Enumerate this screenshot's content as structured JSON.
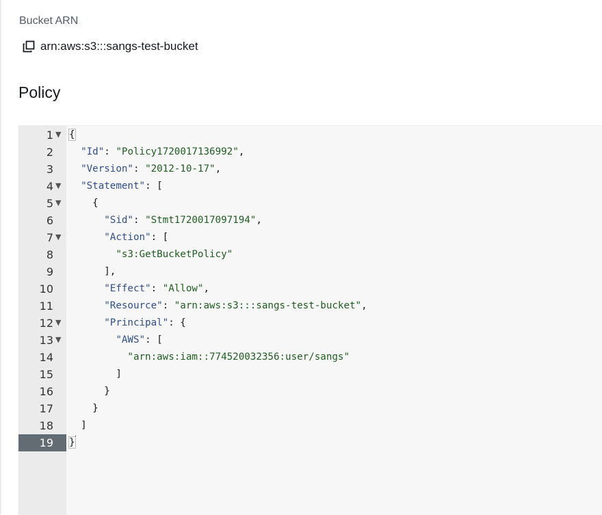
{
  "bucket_arn": {
    "label": "Bucket ARN",
    "value": "arn:aws:s3:::sangs-test-bucket",
    "copy_icon": "copy-icon"
  },
  "policy": {
    "title": "Policy",
    "active_line": 19,
    "lines": [
      {
        "num": "1",
        "fold": true,
        "tokens": [
          [
            "p",
            "{"
          ]
        ]
      },
      {
        "num": "2",
        "fold": false,
        "tokens": [
          [
            "p",
            "  "
          ],
          [
            "k",
            "\"Id\""
          ],
          [
            "p",
            ": "
          ],
          [
            "s",
            "\"Policy1720017136992\""
          ],
          [
            "p",
            ","
          ]
        ]
      },
      {
        "num": "3",
        "fold": false,
        "tokens": [
          [
            "p",
            "  "
          ],
          [
            "k",
            "\"Version\""
          ],
          [
            "p",
            ": "
          ],
          [
            "s",
            "\"2012-10-17\""
          ],
          [
            "p",
            ","
          ]
        ]
      },
      {
        "num": "4",
        "fold": true,
        "tokens": [
          [
            "p",
            "  "
          ],
          [
            "k",
            "\"Statement\""
          ],
          [
            "p",
            ": ["
          ]
        ]
      },
      {
        "num": "5",
        "fold": true,
        "tokens": [
          [
            "p",
            "    {"
          ]
        ]
      },
      {
        "num": "6",
        "fold": false,
        "tokens": [
          [
            "p",
            "      "
          ],
          [
            "k",
            "\"Sid\""
          ],
          [
            "p",
            ": "
          ],
          [
            "s",
            "\"Stmt1720017097194\""
          ],
          [
            "p",
            ","
          ]
        ]
      },
      {
        "num": "7",
        "fold": true,
        "tokens": [
          [
            "p",
            "      "
          ],
          [
            "k",
            "\"Action\""
          ],
          [
            "p",
            ": ["
          ]
        ]
      },
      {
        "num": "8",
        "fold": false,
        "tokens": [
          [
            "p",
            "        "
          ],
          [
            "s",
            "\"s3:GetBucketPolicy\""
          ]
        ]
      },
      {
        "num": "9",
        "fold": false,
        "tokens": [
          [
            "p",
            "      ],"
          ]
        ]
      },
      {
        "num": "10",
        "fold": false,
        "tokens": [
          [
            "p",
            "      "
          ],
          [
            "k",
            "\"Effect\""
          ],
          [
            "p",
            ": "
          ],
          [
            "s",
            "\"Allow\""
          ],
          [
            "p",
            ","
          ]
        ]
      },
      {
        "num": "11",
        "fold": false,
        "tokens": [
          [
            "p",
            "      "
          ],
          [
            "k",
            "\"Resource\""
          ],
          [
            "p",
            ": "
          ],
          [
            "s",
            "\"arn:aws:s3:::sangs-test-bucket\""
          ],
          [
            "p",
            ","
          ]
        ]
      },
      {
        "num": "12",
        "fold": true,
        "tokens": [
          [
            "p",
            "      "
          ],
          [
            "k",
            "\"Principal\""
          ],
          [
            "p",
            ": {"
          ]
        ]
      },
      {
        "num": "13",
        "fold": true,
        "tokens": [
          [
            "p",
            "        "
          ],
          [
            "k",
            "\"AWS\""
          ],
          [
            "p",
            ": ["
          ]
        ]
      },
      {
        "num": "14",
        "fold": false,
        "tokens": [
          [
            "p",
            "          "
          ],
          [
            "s",
            "\"arn:aws:iam::774520032356:user/sangs\""
          ]
        ]
      },
      {
        "num": "15",
        "fold": false,
        "tokens": [
          [
            "p",
            "        ]"
          ]
        ]
      },
      {
        "num": "16",
        "fold": false,
        "tokens": [
          [
            "p",
            "      }"
          ]
        ]
      },
      {
        "num": "17",
        "fold": false,
        "tokens": [
          [
            "p",
            "    }"
          ]
        ]
      },
      {
        "num": "18",
        "fold": false,
        "tokens": [
          [
            "p",
            "  ]"
          ]
        ]
      },
      {
        "num": "19",
        "fold": false,
        "tokens": [
          [
            "p",
            "}"
          ]
        ]
      }
    ]
  }
}
